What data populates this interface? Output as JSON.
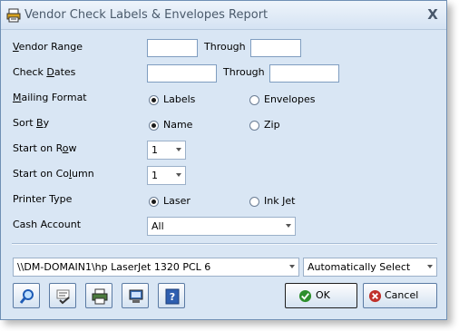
{
  "window": {
    "title": "Vendor Check Labels & Envelopes Report",
    "close_glyph": "X"
  },
  "form": {
    "vendor_range": {
      "label_pre": "V",
      "label_post": "endor Range",
      "from": "",
      "through_label": "Through",
      "to": ""
    },
    "check_dates": {
      "label_pre": "Check ",
      "label_ul": "D",
      "label_post": "ates",
      "from": "",
      "through_label": "Through",
      "to": ""
    },
    "mailing_format": {
      "label_pre": "",
      "label_ul": "M",
      "label_post": "ailing Format",
      "options": [
        "Labels",
        "Envelopes"
      ],
      "selected": "Labels"
    },
    "sort_by": {
      "label_pre": "Sort ",
      "label_ul": "B",
      "label_post": "y",
      "options": [
        "Name",
        "Zip"
      ],
      "selected": "Name"
    },
    "start_row": {
      "label_pre": "Start on R",
      "label_ul": "o",
      "label_post": "w",
      "value": "1"
    },
    "start_column": {
      "label_pre": "Start on Co",
      "label_ul": "l",
      "label_post": "umn",
      "value": "1"
    },
    "printer_type": {
      "label": "Printer Type",
      "options": [
        "Laser",
        "Ink Jet"
      ],
      "selected": "Laser"
    },
    "cash_account": {
      "label": "Cash Account",
      "value": "All"
    }
  },
  "printer": {
    "name": "\\\\DM-DOMAIN1\\hp LaserJet 1320 PCL 6",
    "tray": "Automatically Select"
  },
  "buttons": {
    "ok": "OK",
    "cancel": "Cancel"
  },
  "toolbar_icons": [
    "preview-magnify-icon",
    "spell-check-icon",
    "print-icon",
    "export-icon",
    "help-icon"
  ],
  "colors": {
    "window_bg": "#d9e6f4",
    "border": "#6f8fb4",
    "ok_green": "#2d8f2d",
    "cancel_red": "#c0312b"
  }
}
